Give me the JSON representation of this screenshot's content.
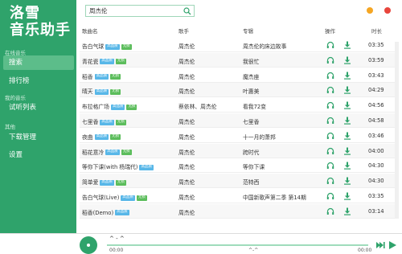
{
  "app": {
    "brand_line1": "洛雪",
    "brand_line2": "音乐助手"
  },
  "sidebar": {
    "sections": [
      {
        "label": "在线音乐",
        "items": [
          {
            "label": "搜索",
            "active": true
          },
          {
            "label": "排行榜",
            "active": false
          }
        ]
      },
      {
        "label": "我的音乐",
        "items": [
          {
            "label": "试听列表",
            "active": false
          }
        ]
      },
      {
        "label": "其他",
        "items": [
          {
            "label": "下载管理",
            "active": false
          },
          {
            "label": "设置",
            "active": false
          }
        ]
      }
    ]
  },
  "search": {
    "value": "周杰伦",
    "placeholder": ""
  },
  "table": {
    "headers": {
      "title": "歌曲名",
      "artist": "歌手",
      "album": "专辑",
      "ops": "操作",
      "time": "时长"
    },
    "rows": [
      {
        "title": "告白气球",
        "badges": [
          "高品质",
          "无损"
        ],
        "artist": "周杰伦",
        "album": "周杰伦的床边故事",
        "time": "03:35"
      },
      {
        "title": "青花瓷",
        "badges": [
          "高品质",
          "无损"
        ],
        "artist": "周杰伦",
        "album": "我很忙",
        "time": "03:59"
      },
      {
        "title": "稻香",
        "badges": [
          "高品质",
          "无损"
        ],
        "artist": "周杰伦",
        "album": "魔杰座",
        "time": "03:43"
      },
      {
        "title": "晴天",
        "badges": [
          "高品质",
          "无损"
        ],
        "artist": "周杰伦",
        "album": "叶惠美",
        "time": "04:29"
      },
      {
        "title": "布拉格广场",
        "badges": [
          "高品质",
          "无损"
        ],
        "artist": "蔡依林、周杰伦",
        "album": "看我72变",
        "time": "04:56"
      },
      {
        "title": "七里香",
        "badges": [
          "高品质",
          "无损"
        ],
        "artist": "周杰伦",
        "album": "七里香",
        "time": "04:58"
      },
      {
        "title": "夜曲",
        "badges": [
          "高品质",
          "无损"
        ],
        "artist": "周杰伦",
        "album": "十一月的萧邦",
        "time": "03:46"
      },
      {
        "title": "稻花意冷",
        "badges": [
          "高品质",
          "无损"
        ],
        "artist": "周杰伦",
        "album": "跨时代",
        "time": "04:00"
      },
      {
        "title": "等你下课(with 杨瑞代)",
        "badges": [
          "高品质"
        ],
        "artist": "周杰伦",
        "album": "等你下课",
        "time": "04:30"
      },
      {
        "title": "简单爱",
        "badges": [
          "高品质",
          "无损"
        ],
        "artist": "周杰伦",
        "album": "范特西",
        "time": "04:30"
      },
      {
        "title": "告白气球(Live)",
        "badges": [
          "高品质",
          "无损"
        ],
        "artist": "周杰伦",
        "album": "中国新歌声第二季 第14期",
        "time": "03:35"
      },
      {
        "title": "稻香(Demo)",
        "badges": [
          "高品质"
        ],
        "artist": "周杰伦",
        "album": "",
        "time": "03:14"
      }
    ]
  },
  "player": {
    "title": "^ - ^",
    "time_current": "00:00",
    "time_center": "^-^",
    "time_total": "00:00",
    "progress": 0.0
  },
  "colors": {
    "accent": "#2fa36b",
    "badge_hq": "#58b7e8",
    "badge_lossless": "#5cbd5c"
  },
  "icons": {
    "search": "search-icon",
    "listen": "headphones-icon",
    "download": "download-icon",
    "next": "next-icon",
    "play": "play-icon",
    "disc": "disc-icon"
  }
}
